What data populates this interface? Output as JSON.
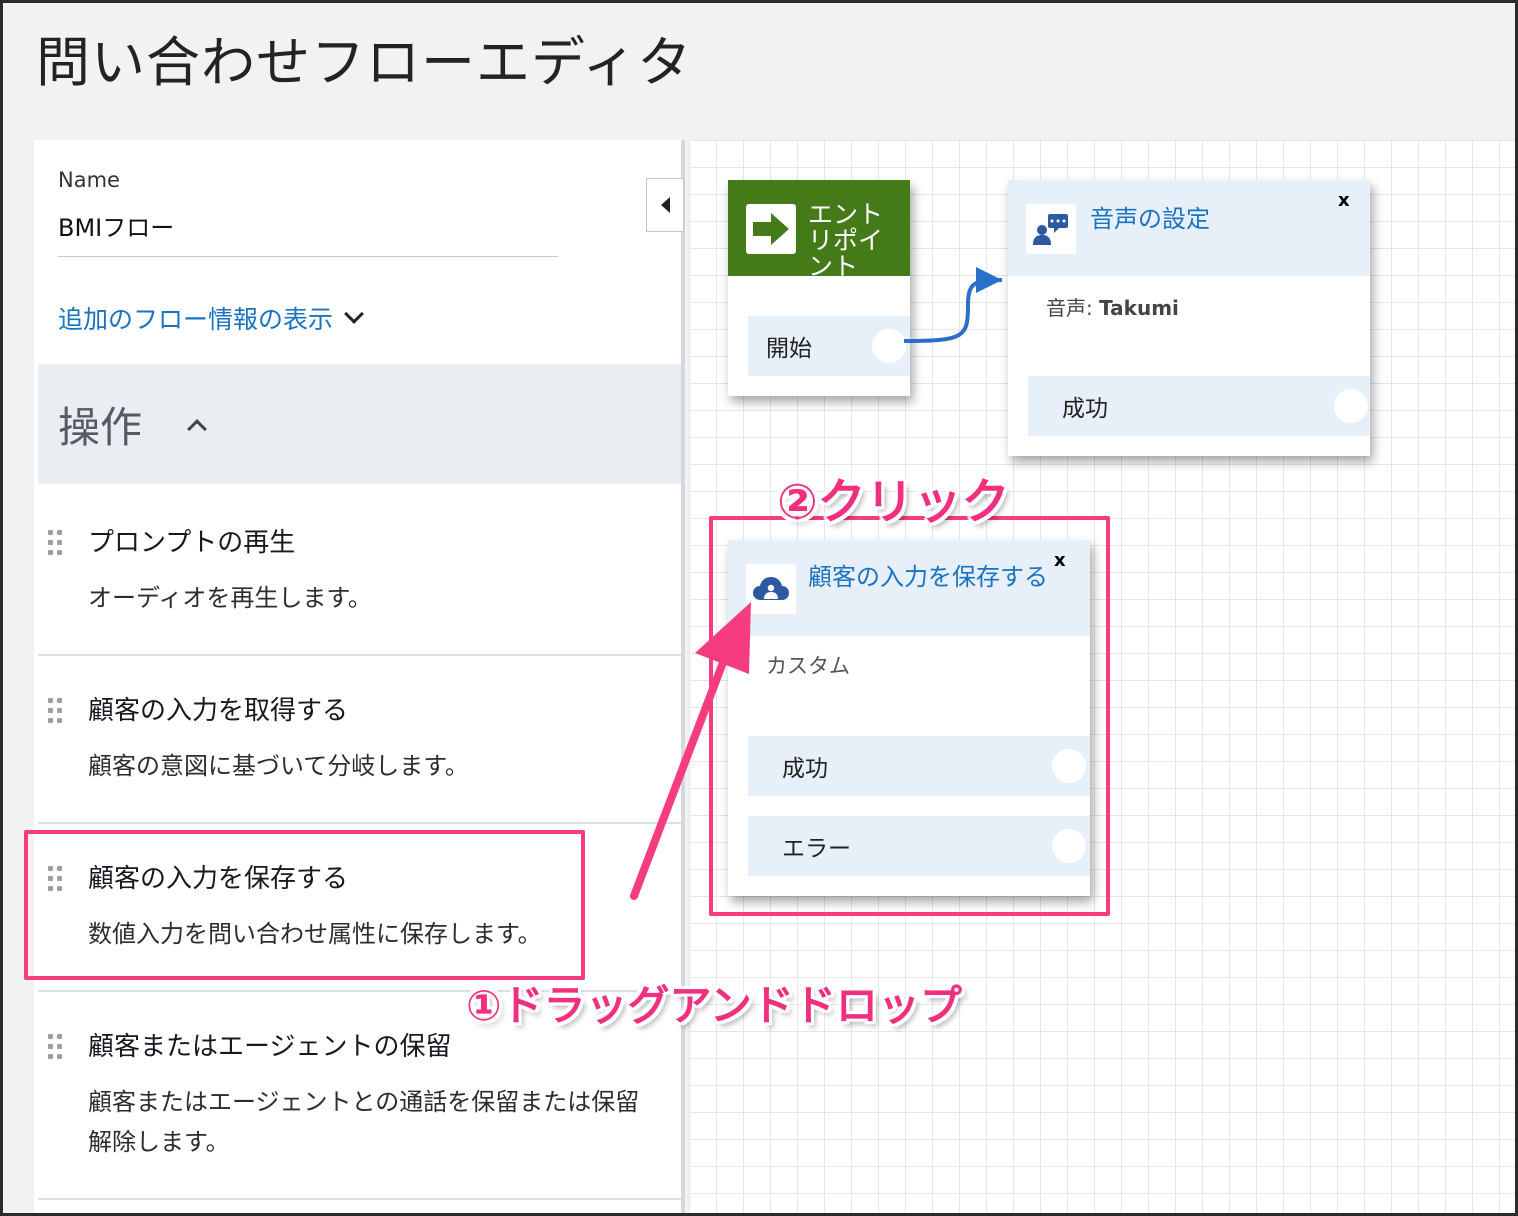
{
  "page": {
    "title": "問い合わせフローエディタ"
  },
  "sidebar": {
    "name_label": "Name",
    "name_value": "BMIフロー",
    "more_info": "追加のフロー情報の表示",
    "section_title": "操作",
    "actions": [
      {
        "title": "プロンプトの再生",
        "description": "オーディオを再生します。"
      },
      {
        "title": "顧客の入力を取得する",
        "description": "顧客の意図に基づいて分岐します。"
      },
      {
        "title": "顧客の入力を保存する",
        "description": "数値入力を問い合わせ属性に保存します。"
      },
      {
        "title": "顧客またはエージェントの保留",
        "description": "顧客またはエージェントとの通話を保留または保留解除します。"
      }
    ]
  },
  "canvas": {
    "entry_block": {
      "title": "エントリポイント",
      "branch": "開始",
      "header_color": "#447a18"
    },
    "voice_block": {
      "title": "音声の設定",
      "close": "x",
      "voice_key": "音声:",
      "voice_value": "Takumi",
      "branch": "成功"
    },
    "store_block": {
      "title": "顧客の入力を保存する",
      "close": "x",
      "subtitle": "カスタム",
      "branches": [
        "成功",
        "エラー"
      ]
    }
  },
  "annotations": {
    "click_label": "②クリック",
    "drag_label": "①ドラッグアンドドロップ",
    "highlight_color": "#f53c7f"
  },
  "icons": [
    "collapse-left-icon",
    "chevron-down-icon",
    "chevron-up-icon",
    "drag-handle-icon",
    "arrow-right-icon",
    "voice-chat-icon",
    "cloud-user-icon"
  ]
}
